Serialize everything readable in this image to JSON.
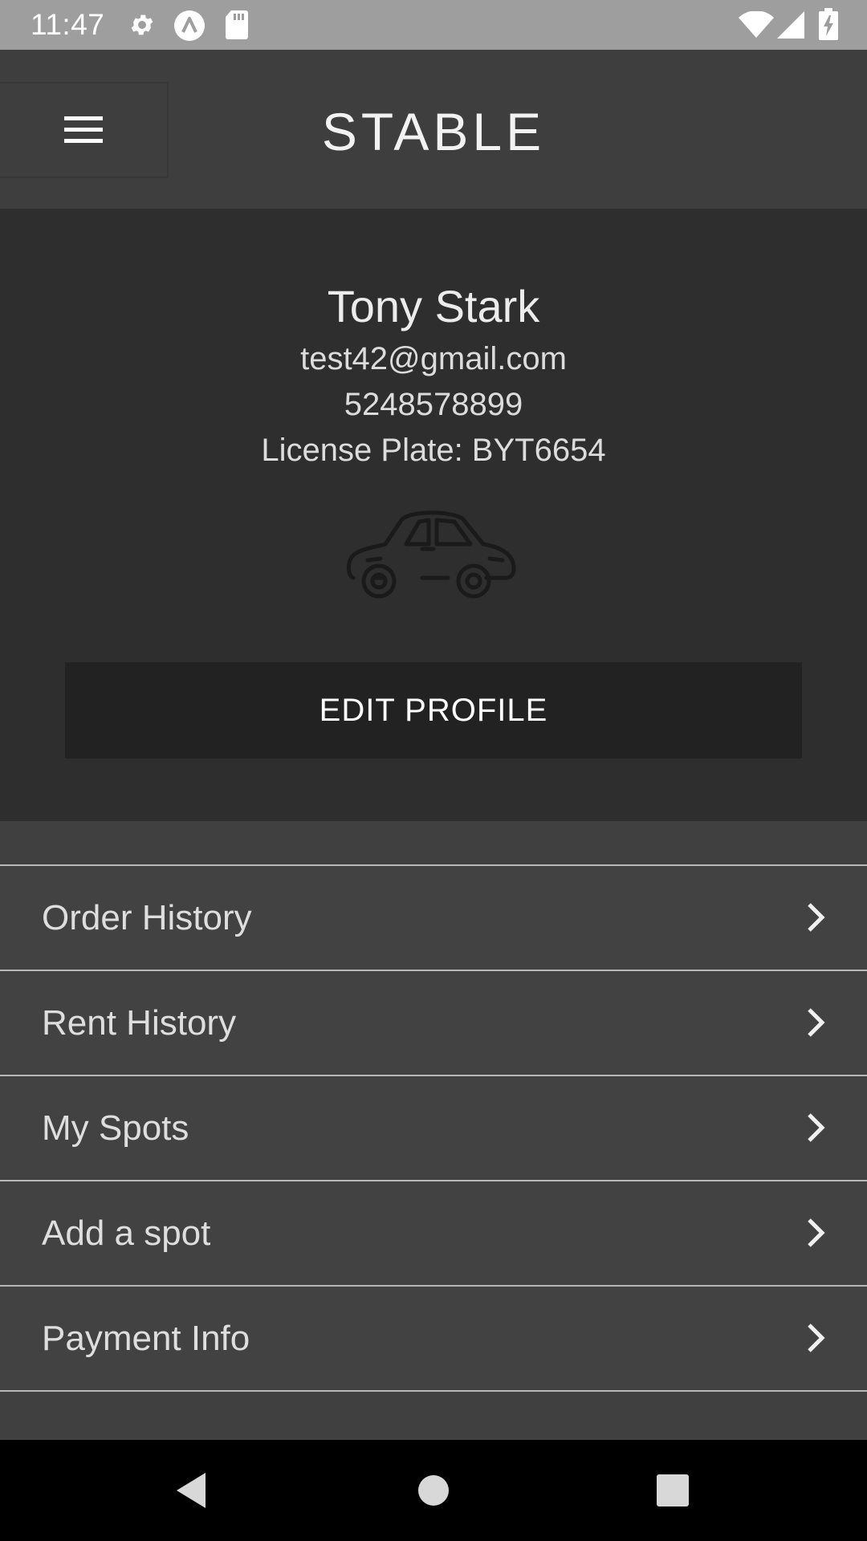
{
  "status_bar": {
    "time": "11:47",
    "icons": [
      "settings-icon",
      "app-a-icon",
      "sd-card-icon",
      "wifi-icon",
      "cellular-signal-icon",
      "battery-charging-icon"
    ]
  },
  "header": {
    "title": "STABLE",
    "menu_icon": "hamburger-menu-icon"
  },
  "profile": {
    "name": "Tony Stark",
    "email": "test42@gmail.com",
    "phone": "5248578899",
    "license_plate": "License Plate: BYT6654",
    "vehicle_icon": "car-icon",
    "edit_button_label": "EDIT PROFILE"
  },
  "menu": {
    "items": [
      {
        "label": "Order History"
      },
      {
        "label": "Rent History"
      },
      {
        "label": "My Spots"
      },
      {
        "label": "Add a spot"
      },
      {
        "label": "Payment Info"
      }
    ],
    "chevron_icon": "chevron-right-icon"
  },
  "nav_bar": {
    "icons": [
      "back-icon",
      "home-icon",
      "recents-icon"
    ]
  },
  "colors": {
    "status_bar": "#9e9e9e",
    "header_bg": "#3e3e3e",
    "profile_bg": "#2e2e2e",
    "button_bg": "#222222",
    "list_bg": "#424242",
    "divider": "#b8b8b8"
  }
}
